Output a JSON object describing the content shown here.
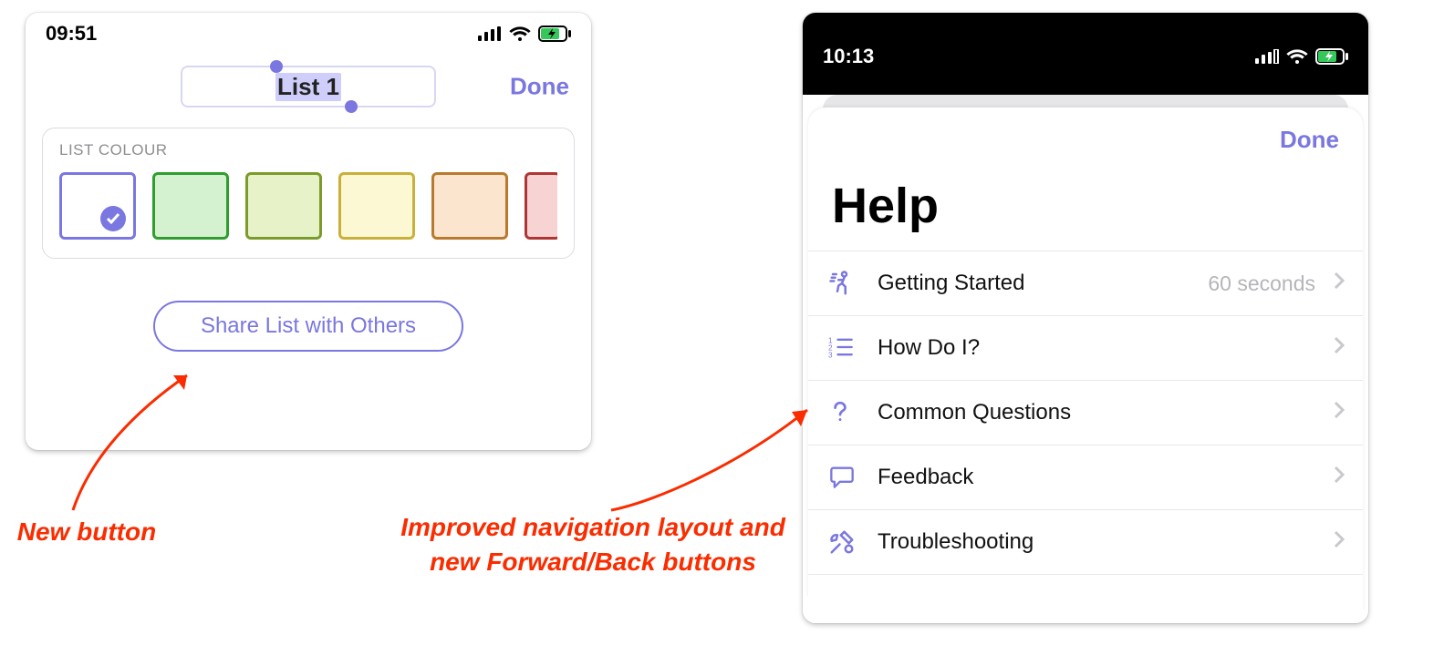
{
  "left": {
    "statusbar_time": "09:51",
    "title_field_value": "List 1",
    "done_label": "Done",
    "section_label": "LIST COLOUR",
    "share_button_label": "Share List with Others",
    "swatches": [
      {
        "name": "white",
        "selected": true
      },
      {
        "name": "green",
        "selected": false
      },
      {
        "name": "olive",
        "selected": false
      },
      {
        "name": "yellow",
        "selected": false
      },
      {
        "name": "orange",
        "selected": false
      },
      {
        "name": "red",
        "selected": false
      }
    ]
  },
  "right": {
    "statusbar_time": "10:13",
    "done_label": "Done",
    "page_title": "Help",
    "rows": [
      {
        "icon": "walk-icon",
        "label": "Getting Started",
        "trailing": "60 seconds"
      },
      {
        "icon": "numbered-list-icon",
        "label": "How Do I?",
        "trailing": ""
      },
      {
        "icon": "question-icon",
        "label": "Common Questions",
        "trailing": ""
      },
      {
        "icon": "speech-icon",
        "label": "Feedback",
        "trailing": ""
      },
      {
        "icon": "tools-icon",
        "label": "Troubleshooting",
        "trailing": ""
      }
    ]
  },
  "annotations": {
    "left_caption": "New button",
    "right_caption": "Improved navigation layout and\nnew Forward/Back buttons"
  }
}
